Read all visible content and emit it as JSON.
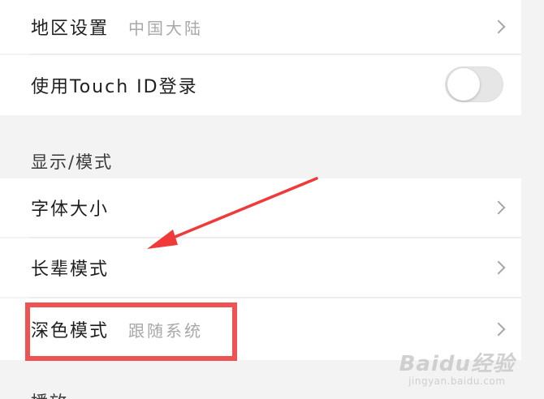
{
  "settings": {
    "region": {
      "label": "地区设置",
      "value": "中国大陆"
    },
    "touch_id": {
      "label": "使用Touch ID登录",
      "enabled": false
    },
    "display_section": {
      "title": "显示/模式"
    },
    "font_size": {
      "label": "字体大小"
    },
    "elder_mode": {
      "label": "长辈模式"
    },
    "dark_mode": {
      "label": "深色模式",
      "value": "跟随系统"
    },
    "next_section": {
      "title": "播放"
    }
  },
  "annotation": {
    "arrow_color": "#f03a3a",
    "highlight_color": "#ef5252"
  },
  "watermark": {
    "brand": "Baidu经验",
    "url": "jingyan.baidu.com"
  },
  "icons": [
    "chevron-right-icon",
    "toggle-switch"
  ]
}
